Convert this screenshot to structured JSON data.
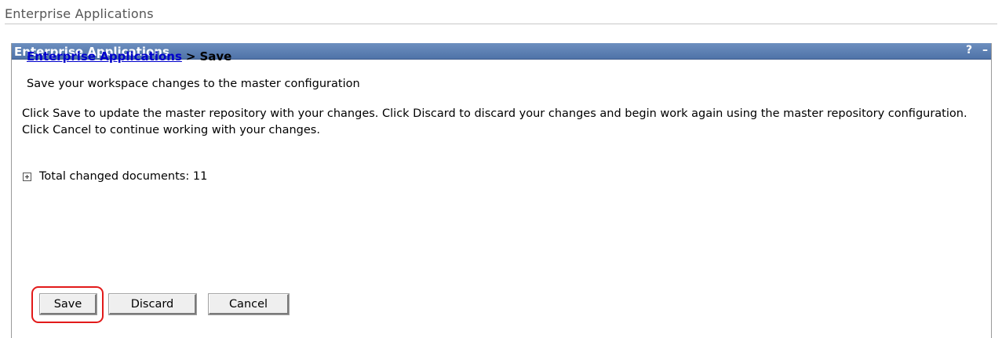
{
  "page": {
    "header": "Enterprise Applications"
  },
  "portlet": {
    "title": "Enterprise Applications",
    "help_glyph": "?",
    "minimize_glyph": "–"
  },
  "breadcrumb": {
    "link": "Enterprise Applications",
    "separator": ">",
    "current": "Save"
  },
  "content": {
    "subtitle": "Save your workspace changes to the master configuration",
    "description": "Click Save to update the master repository with your changes. Click Discard to discard your changes and begin work again using the master repository configuration. Click Cancel to continue working with your changes.",
    "changed_documents": "Total changed documents: 11"
  },
  "buttons": {
    "save": "Save",
    "discard": "Discard",
    "cancel": "Cancel"
  },
  "icons": {
    "expand": "plus-box-icon",
    "help": "question-icon",
    "minimize": "minimize-icon"
  },
  "colors": {
    "titlebar": "#4f73a8",
    "link": "#0000cc",
    "highlight": "#e21a1a"
  }
}
